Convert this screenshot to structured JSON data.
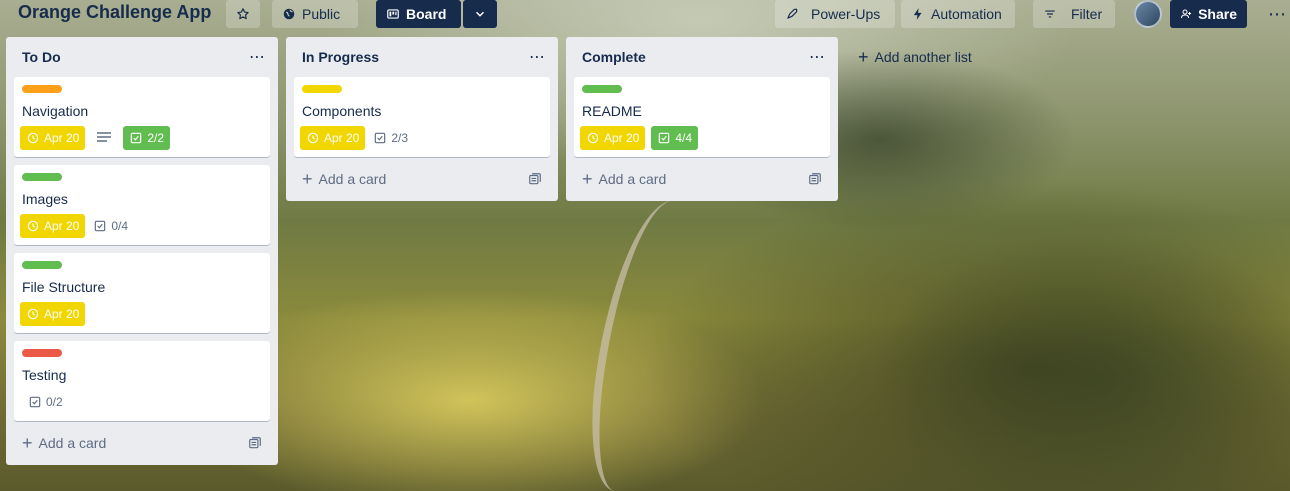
{
  "header": {
    "board_title": "Orange Challenge App",
    "visibility": "Public",
    "view": "Board",
    "power_ups": "Power-Ups",
    "automation": "Automation",
    "filter": "Filter",
    "share": "Share",
    "more": "⋯"
  },
  "lists": [
    {
      "title": "To Do",
      "menu": "⋯",
      "add_card": "Add a card",
      "cards": [
        {
          "label_color": "#ff9f1a",
          "title": "Navigation",
          "due": "Apr 20",
          "has_description": true,
          "checklist": "2/2",
          "checklist_complete": true
        },
        {
          "label_color": "#61bd4f",
          "title": "Images",
          "due": "Apr 20",
          "checklist": "0/4",
          "checklist_complete": false
        },
        {
          "label_color": "#61bd4f",
          "title": "File Structure",
          "due": "Apr 20"
        },
        {
          "label_color": "#eb5a46",
          "title": "Testing",
          "checklist": "0/2",
          "checklist_complete": false
        }
      ]
    },
    {
      "title": "In Progress",
      "menu": "⋯",
      "add_card": "Add a card",
      "cards": [
        {
          "label_color": "#f2d600",
          "title": "Components",
          "due": "Apr 20",
          "checklist": "2/3",
          "checklist_complete": false
        }
      ]
    },
    {
      "title": "Complete",
      "menu": "⋯",
      "add_card": "Add a card",
      "cards": [
        {
          "label_color": "#61bd4f",
          "title": "README",
          "due": "Apr 20",
          "checklist": "4/4",
          "checklist_complete": true
        }
      ]
    }
  ],
  "add_list": "Add another list",
  "colors": {
    "due_badge": "#f2d600",
    "complete_badge": "#61bd4f",
    "header_dark": "#172b4d",
    "list_bg": "#ebecf0"
  }
}
